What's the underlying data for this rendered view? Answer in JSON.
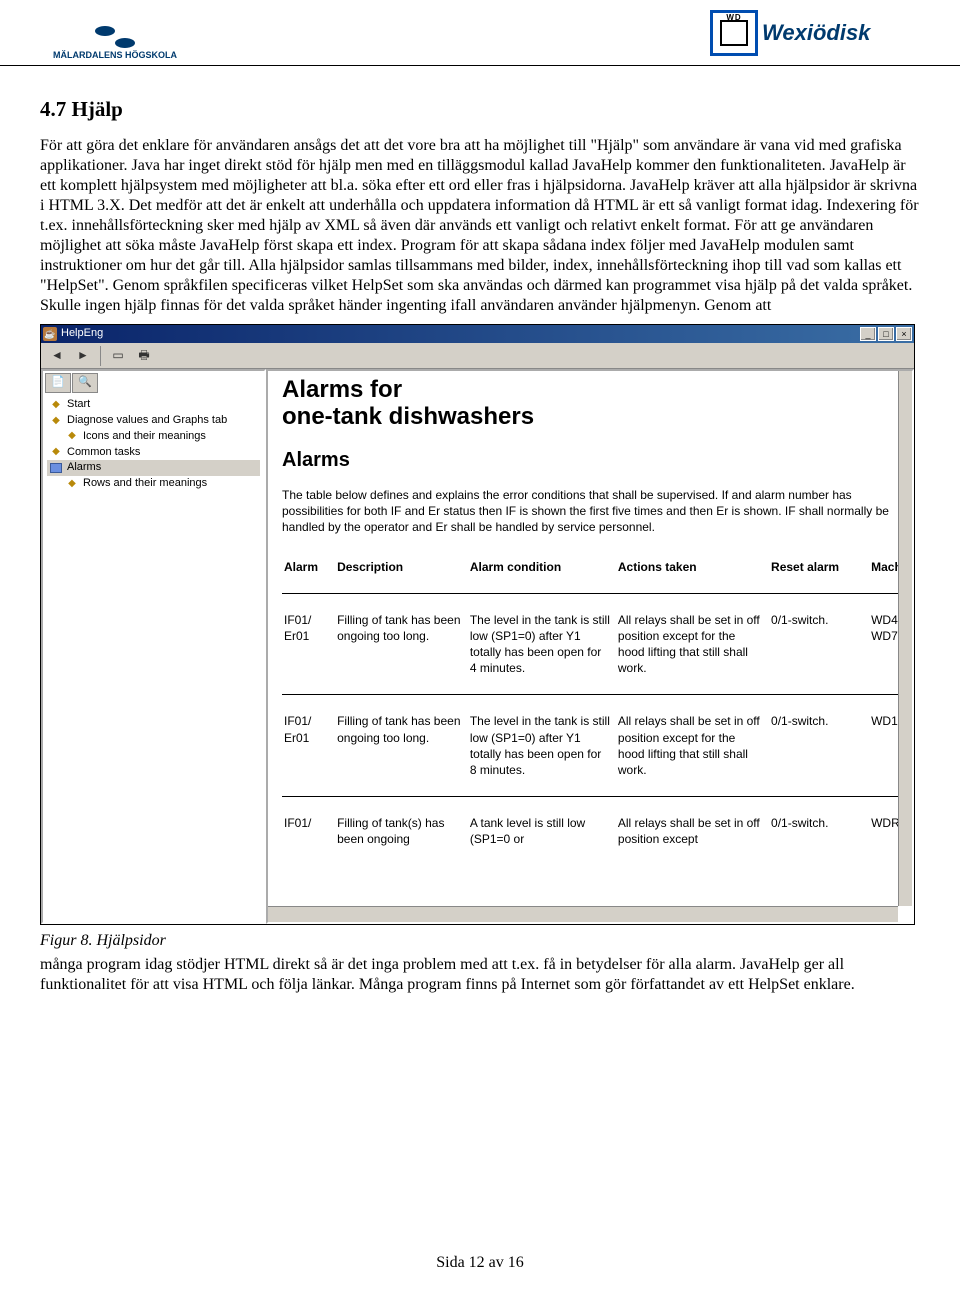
{
  "header": {
    "left_logo_text": "MÄLARDALENS HÖGSKOLA",
    "right_logo_text": "Wexiödisk",
    "right_logo_wd": "WD"
  },
  "section": {
    "heading": "4.7 Hjälp",
    "paragraph1": "För att göra det enklare för användaren ansågs det att det vore bra att ha möjlighet till \"Hjälp\" som användare är vana vid med grafiska applikationer. Java har inget direkt stöd för hjälp men med en tilläggsmodul kallad JavaHelp kommer den funktionaliteten. JavaHelp är ett komplett hjälpsystem med möjligheter att bl.a. söka efter ett ord eller fras i hjälpsidorna. JavaHelp kräver att alla hjälpsidor är skrivna i HTML 3.X. Det medför att det är enkelt att underhålla och uppdatera information då HTML är ett så vanligt format idag. Indexering för t.ex. innehållsförteckning sker med hjälp av XML så även där används ett vanligt och relativt enkelt format. För att ge användaren möjlighet att söka måste JavaHelp först skapa ett index. Program för att skapa sådana index följer med JavaHelp modulen samt instruktioner om hur det går till. Alla hjälpsidor samlas tillsammans med bilder, index, innehållsförteckning ihop till vad som kallas ett \"HelpSet\". Genom språkfilen specificeras vilket HelpSet som ska användas och därmed kan programmet visa hjälp på det valda språket. Skulle ingen hjälp finnas för det valda språket händer ingenting ifall användaren använder hjälpmenyn. Genom att",
    "paragraph2": "många program idag stödjer HTML direkt så är det inga problem med att t.ex. få in betydelser för alla alarm. JavaHelp ger all funktionalitet för att visa HTML och följa länkar. Många program finns på Internet som gör författandet av ett HelpSet enklare.",
    "figure_caption": "Figur 8. Hjälpsidor"
  },
  "window": {
    "title": "HelpEng",
    "minimize": "_",
    "maximize": "□",
    "close": "×",
    "toolbar": {
      "back": "◄",
      "forward": "►",
      "page_setup": "▭",
      "print": "🖶"
    },
    "tree_tabs": {
      "contents": "📄",
      "search": "🔍"
    },
    "tree": [
      {
        "label": "Start",
        "icon": "bullet"
      },
      {
        "label": "Diagnose values and Graphs tab",
        "icon": "bullet"
      },
      {
        "label": "Icons and their meanings",
        "icon": "bullet",
        "indent": true
      },
      {
        "label": "Common tasks",
        "icon": "bullet"
      },
      {
        "label": "Alarms",
        "icon": "book",
        "selected": true
      },
      {
        "label": "Rows and their meanings",
        "icon": "bullet",
        "indent": true
      }
    ],
    "help": {
      "h1_line1": "Alarms for",
      "h1_line2": "one-tank dishwashers",
      "h2": "Alarms",
      "intro": "The table below defines and explains the error conditions that shall be supervised. If and alarm number has possibilities for both IF and Er status then IF is shown the first five times and then Er is shown. IF shall normally be handled by the operator and Er shall be handled by service personnel.",
      "columns": [
        "Alarm",
        "Description",
        "Alarm condition",
        "Actions taken",
        "Reset alarm",
        "Mach"
      ],
      "rows": [
        {
          "alarm": "IF01/ Er01",
          "description": "Filling of tank has been ongoing too long.",
          "condition": "The level in the tank is still low (SP1=0) after Y1 totally has been open for 4 minutes.",
          "actions": "All relays shall be set in off position except for the hood lifting that still shall work.",
          "reset": "0/1-switch.",
          "mach": "WD4 WD7"
        },
        {
          "alarm": "IF01/ Er01",
          "description": "Filling of tank has been ongoing too long.",
          "condition": "The level in the tank is still low (SP1=0) after Y1 totally has been open for 8 minutes.",
          "actions": "All relays shall be set in off position except for the hood lifting that still shall work.",
          "reset": "0/1-switch.",
          "mach": "WD1"
        },
        {
          "alarm": "IF01/",
          "description": "Filling of tank(s) has been ongoing",
          "condition": "A tank level is still low (SP1=0 or",
          "actions": "All relays shall be set in off position except",
          "reset": "0/1-switch.",
          "mach": "WDR"
        }
      ]
    }
  },
  "footer": {
    "page_text": "Sida 12 av 16"
  }
}
